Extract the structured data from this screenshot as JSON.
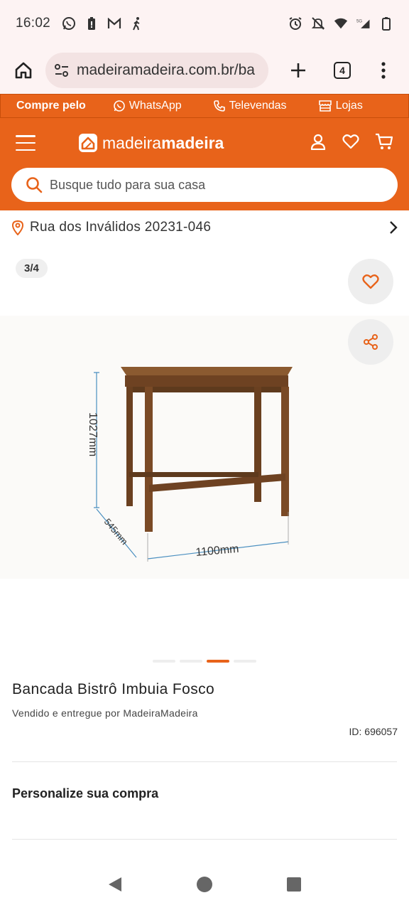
{
  "status_bar": {
    "time": "16:02",
    "left_icons": [
      "whatsapp-icon",
      "battery-saver-icon",
      "gmail-icon",
      "walking-icon"
    ],
    "right_icons": [
      "alarm-icon",
      "mute-icon",
      "wifi-icon",
      "signal-5g-icon",
      "battery-icon"
    ]
  },
  "browser": {
    "url": "madeiramadeira.com.br/ba",
    "tab_count": "4"
  },
  "top_strip": {
    "compre": "Compre pelo",
    "whatsapp": "WhatsApp",
    "televendas": "Televendas",
    "lojas": "Lojas"
  },
  "header": {
    "logo_regular": "madeira",
    "logo_bold": "madeira",
    "search_placeholder": "Busque tudo para sua casa"
  },
  "address": {
    "text": "Rua dos Inválidos 20231-046"
  },
  "gallery": {
    "counter": "3/4",
    "dim_height": "1027mm",
    "dim_depth": "545mm",
    "dim_width": "1100mm",
    "total_images": 4,
    "active_index": 3
  },
  "product": {
    "title": "Bancada Bistrô Imbuia Fosco",
    "seller": "Vendido e entregue por MadeiraMadeira",
    "id": "ID: 696057",
    "personalize": "Personalize sua compra"
  },
  "colors": {
    "brand_orange": "#e8631a",
    "wood": "#7a4a26"
  }
}
